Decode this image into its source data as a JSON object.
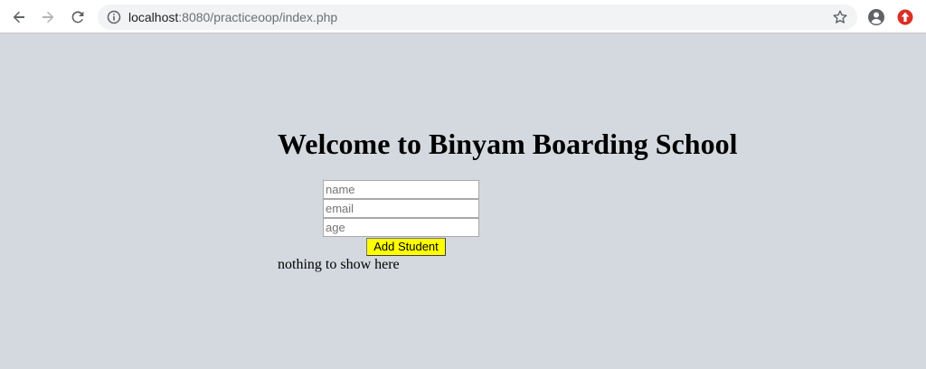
{
  "browser": {
    "url_host": "localhost",
    "url_path": ":8080/practiceoop/index.php",
    "icons": [
      "back-arrow-icon",
      "forward-arrow-icon",
      "reload-icon",
      "info-icon",
      "star-icon",
      "profile-icon",
      "extension-icon"
    ],
    "extension_color": "#d93025"
  },
  "page": {
    "title": "Welcome to Binyam Boarding School",
    "form": {
      "name_placeholder": "name",
      "email_placeholder": "email",
      "age_placeholder": "age",
      "submit_label": "Add Student",
      "submit_color": "#ffff00"
    },
    "empty_message": "nothing to show here",
    "background_color": "#d4d9df"
  }
}
